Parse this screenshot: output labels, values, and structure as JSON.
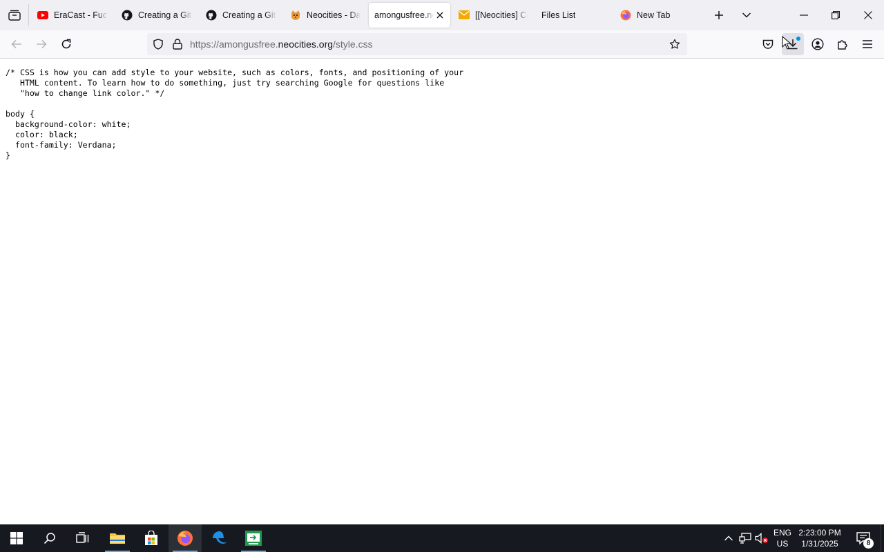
{
  "tabs": [
    {
      "title": "EraCast - Fucky",
      "favicon": "youtube-icon"
    },
    {
      "title": "Creating a GitH",
      "favicon": "github-icon"
    },
    {
      "title": "Creating a GitH",
      "favicon": "github-icon"
    },
    {
      "title": "Neocities - Das",
      "favicon": "neocities-cat-icon"
    },
    {
      "title": "amongusfree.ne",
      "favicon": "none",
      "active": true
    },
    {
      "title": "[[Neocities] Co",
      "favicon": "mail-icon"
    },
    {
      "title": "Files List",
      "favicon": "none"
    },
    {
      "title": "New Tab",
      "favicon": "firefox-icon"
    }
  ],
  "urlbar": {
    "url_prefix": "https://amongusfree.",
    "url_host": "neocities.org",
    "url_path": "/style.css"
  },
  "page": {
    "code_lines": [
      "/* CSS is how you can add style to your website, such as colors, fonts, and positioning of your",
      "   HTML content. To learn how to do something, just try searching Google for questions like",
      "   \"how to change link color.\" */",
      "",
      "body {",
      "  background-color: white;",
      "  color: black;",
      "  font-family: Verdana;",
      "}"
    ]
  },
  "taskbar": {
    "lang_line1": "ENG",
    "lang_line2": "US",
    "time": "2:23:00 PM",
    "date": "1/31/2025",
    "notification_count": "8"
  },
  "colors": {
    "tabstrip_bg": "#f0f0f4",
    "navbar_bg": "#f9f9fb",
    "taskbar_bg": "#16191f",
    "accent": "#0090ed"
  }
}
